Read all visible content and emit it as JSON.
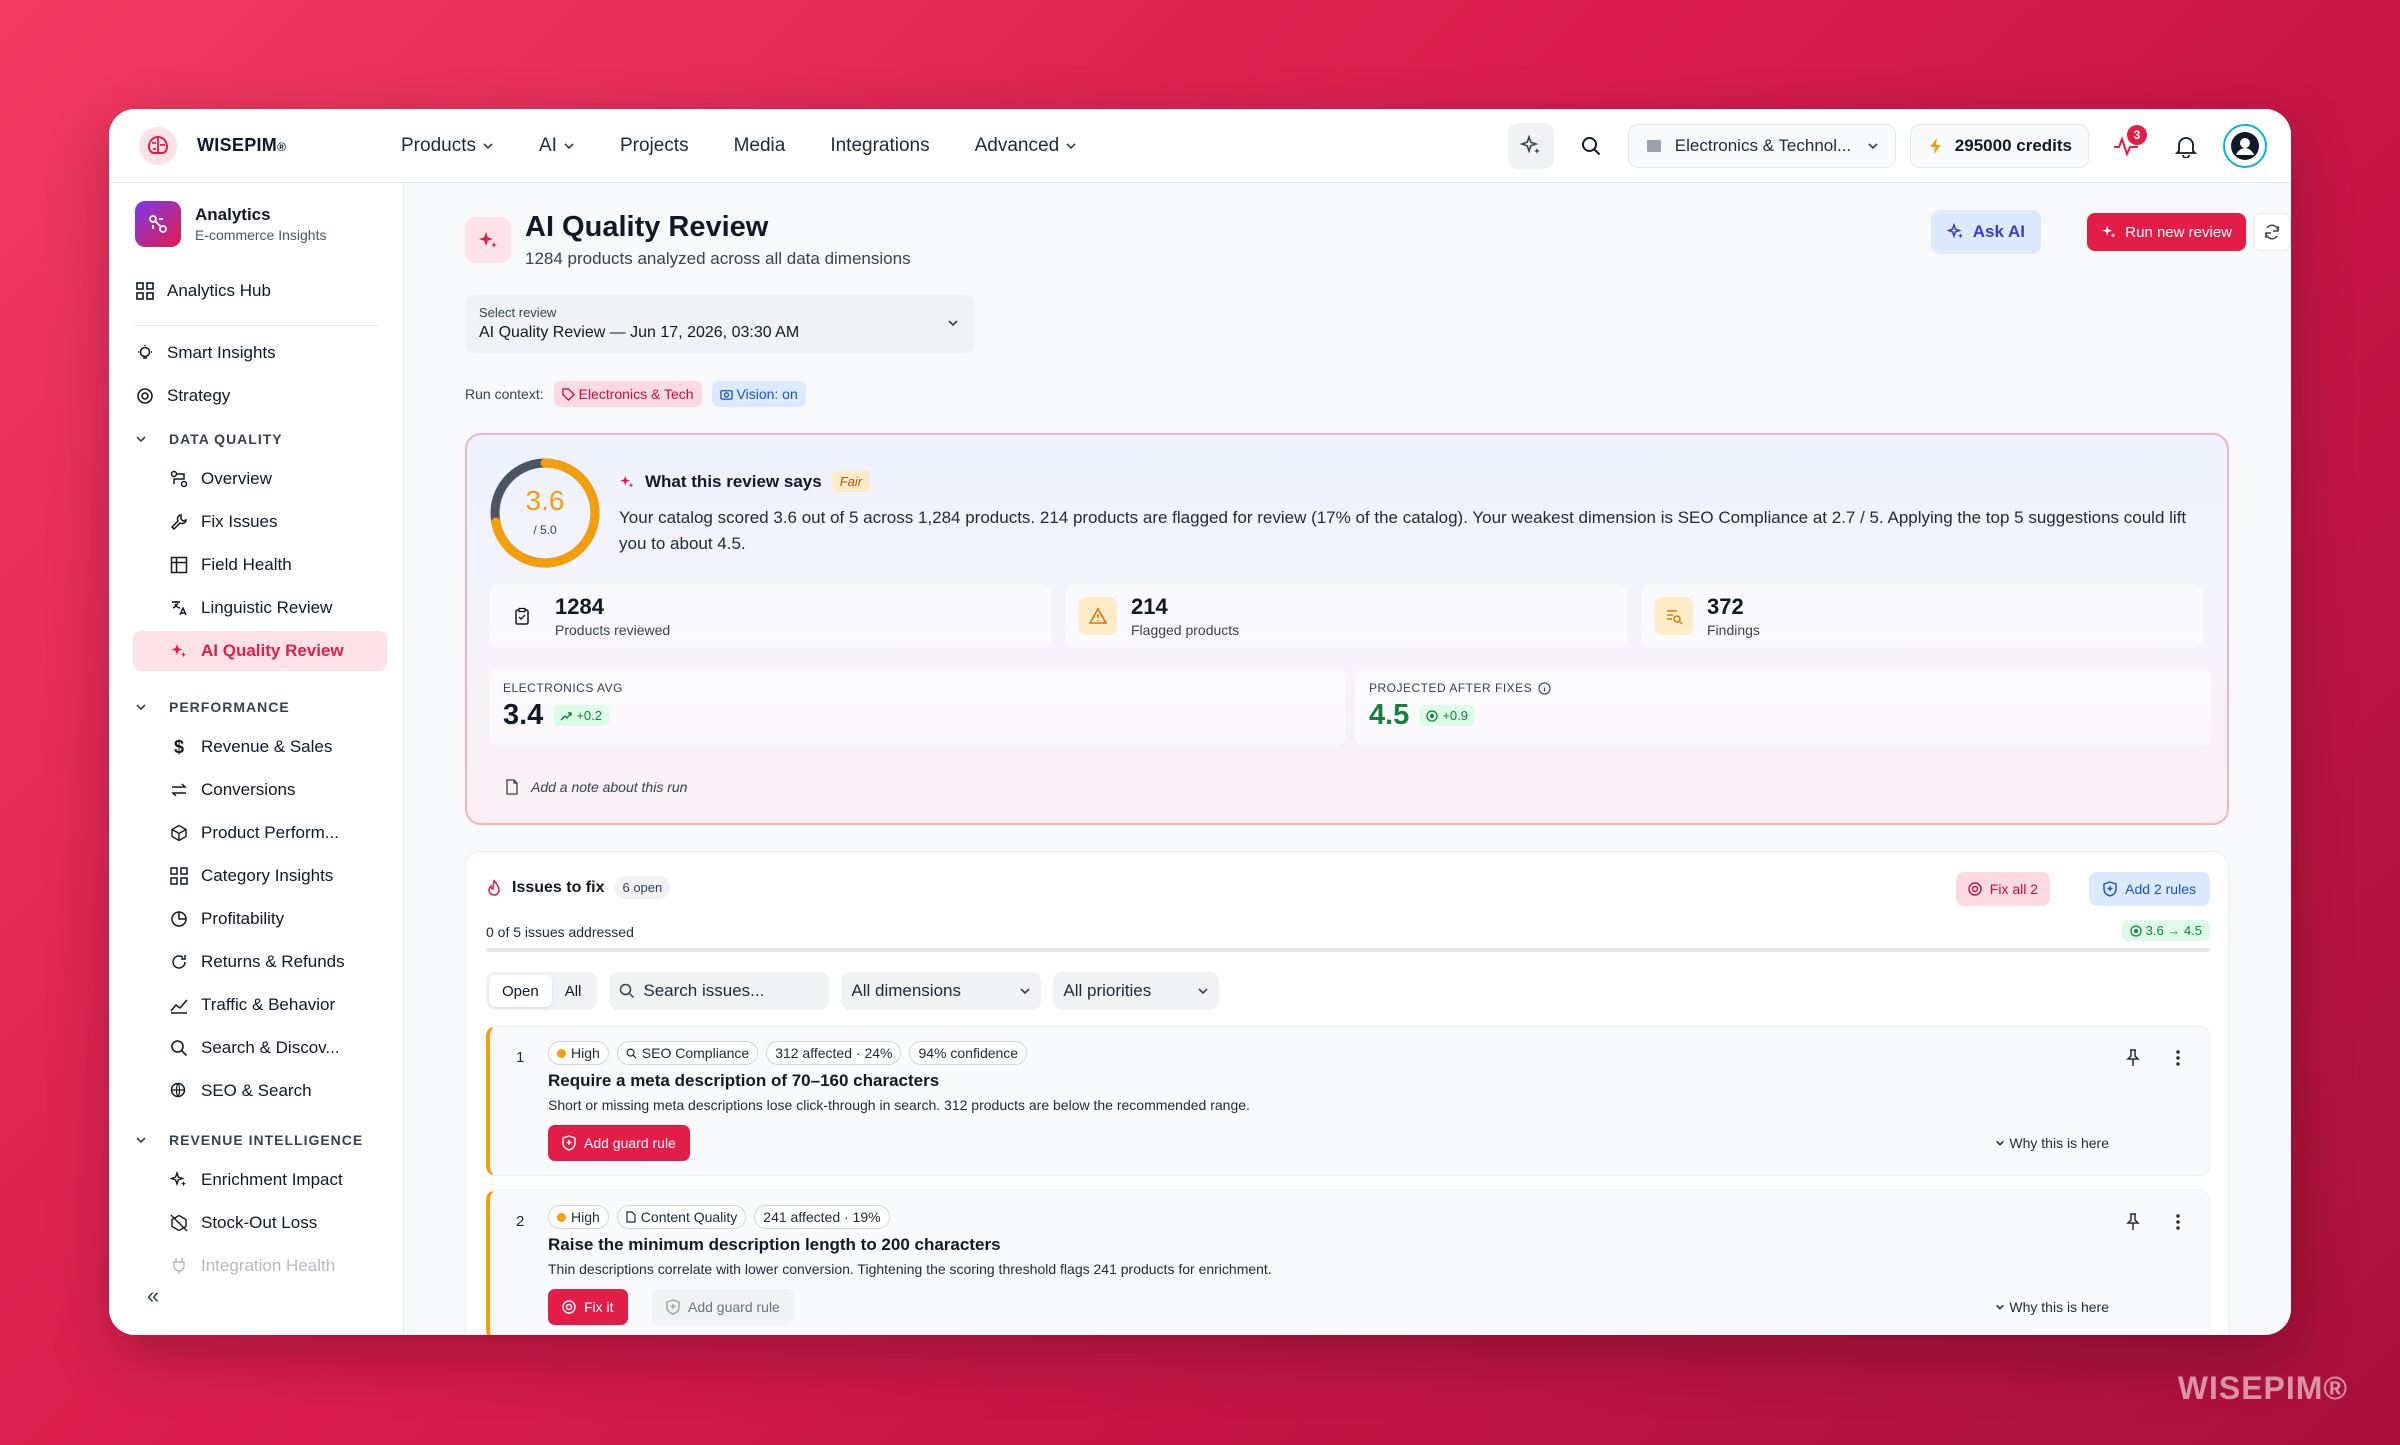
{
  "brand": {
    "name": "WISEPIM",
    "mark": "®"
  },
  "nav": [
    {
      "label": "Products",
      "dropdown": true
    },
    {
      "label": "AI",
      "dropdown": true
    },
    {
      "label": "Projects",
      "dropdown": false
    },
    {
      "label": "Media",
      "dropdown": false
    },
    {
      "label": "Integrations",
      "dropdown": false
    },
    {
      "label": "Advanced",
      "dropdown": true
    }
  ],
  "topbar": {
    "workspace": "Electronics & Technol...",
    "credits": "295000 credits",
    "activity_badge": "3"
  },
  "sidebar": {
    "title": "Analytics",
    "subtitle": "E-commerce Insights",
    "hub": "Analytics Hub",
    "items_top": [
      "Smart Insights",
      "Strategy"
    ],
    "section_dq": "DATA QUALITY",
    "dq_items": [
      "Overview",
      "Fix Issues",
      "Field Health",
      "Linguistic Review",
      "AI Quality Review"
    ],
    "section_perf": "PERFORMANCE",
    "perf_items": [
      "Revenue & Sales",
      "Conversions",
      "Product Perform...",
      "Category Insights",
      "Profitability",
      "Returns & Refunds",
      "Traffic & Behavior",
      "Search & Discov...",
      "SEO & Search"
    ],
    "section_rev": "REVENUE INTELLIGENCE",
    "rev_items": [
      "Enrichment Impact",
      "Stock-Out Loss",
      "Integration Health"
    ],
    "collapse": "«"
  },
  "page": {
    "title": "AI Quality Review",
    "subtitle": "1284 products analyzed across all data dimensions",
    "ask_ai": "Ask AI",
    "run_new": "Run new review",
    "select_label": "Select review",
    "select_value": "AI Quality Review — Jun 17, 2026, 03:30 AM",
    "run_context_label": "Run context:",
    "ctx_category": "Electronics & Tech",
    "ctx_vision": "Vision: on"
  },
  "summary": {
    "score": "3.6",
    "score_max": "/ 5.0",
    "score_value": 3.6,
    "score_scale": 5,
    "heading": "What this review says",
    "grade": "Fair",
    "text": "Your catalog scored 3.6 out of 5 across 1,284 products. 214 products are flagged for review (17% of the catalog). Your weakest dimension is SEO Compliance at 2.7 / 5. Applying the top 5 suggestions could lift you to about 4.5.",
    "stats": [
      {
        "num": "1284",
        "cap": "Products reviewed"
      },
      {
        "num": "214",
        "cap": "Flagged products"
      },
      {
        "num": "372",
        "cap": "Findings"
      }
    ],
    "avg_label": "ELECTRONICS AVG",
    "avg_value": "3.4",
    "avg_delta": "+0.2",
    "proj_label": "PROJECTED AFTER FIXES",
    "proj_value": "4.5",
    "proj_delta": "+0.9",
    "note": "Add a note about this run"
  },
  "issues": {
    "title": "Issues to fix",
    "open_count": "6 open",
    "fix_all": "Fix all 2",
    "add_rules": "Add 2 rules",
    "addressed": "0 of 5 issues addressed",
    "score_range": "3.6 → 4.5",
    "progress": 0,
    "tab_open": "Open",
    "tab_all": "All",
    "search_placeholder": "Search issues...",
    "dimensions": "All dimensions",
    "priorities": "All priorities",
    "rows": [
      {
        "num": "1",
        "priority": "High",
        "dimension": "SEO Compliance",
        "affected": "312 affected · 24%",
        "confidence": "94% confidence",
        "title": "Require a meta description of 70–160 characters",
        "desc": "Short or missing meta descriptions lose click-through in search. 312 products are below the recommended range.",
        "primary_btn": "Add guard rule",
        "why": "Why this is here"
      },
      {
        "num": "2",
        "priority": "High",
        "dimension": "Content Quality",
        "affected": "241 affected · 19%",
        "title": "Raise the minimum description length to 200 characters",
        "desc": "Thin descriptions correlate with lower conversion. Tightening the scoring threshold flags 241 products for enrichment.",
        "primary_btn": "Fix it",
        "secondary_btn": "Add guard rule",
        "why": "Why this is here"
      }
    ]
  },
  "watermark": "WISEPIM®",
  "colors": {
    "accent": "#e11d48",
    "warning": "#f59e0b",
    "success": "#15803d"
  }
}
